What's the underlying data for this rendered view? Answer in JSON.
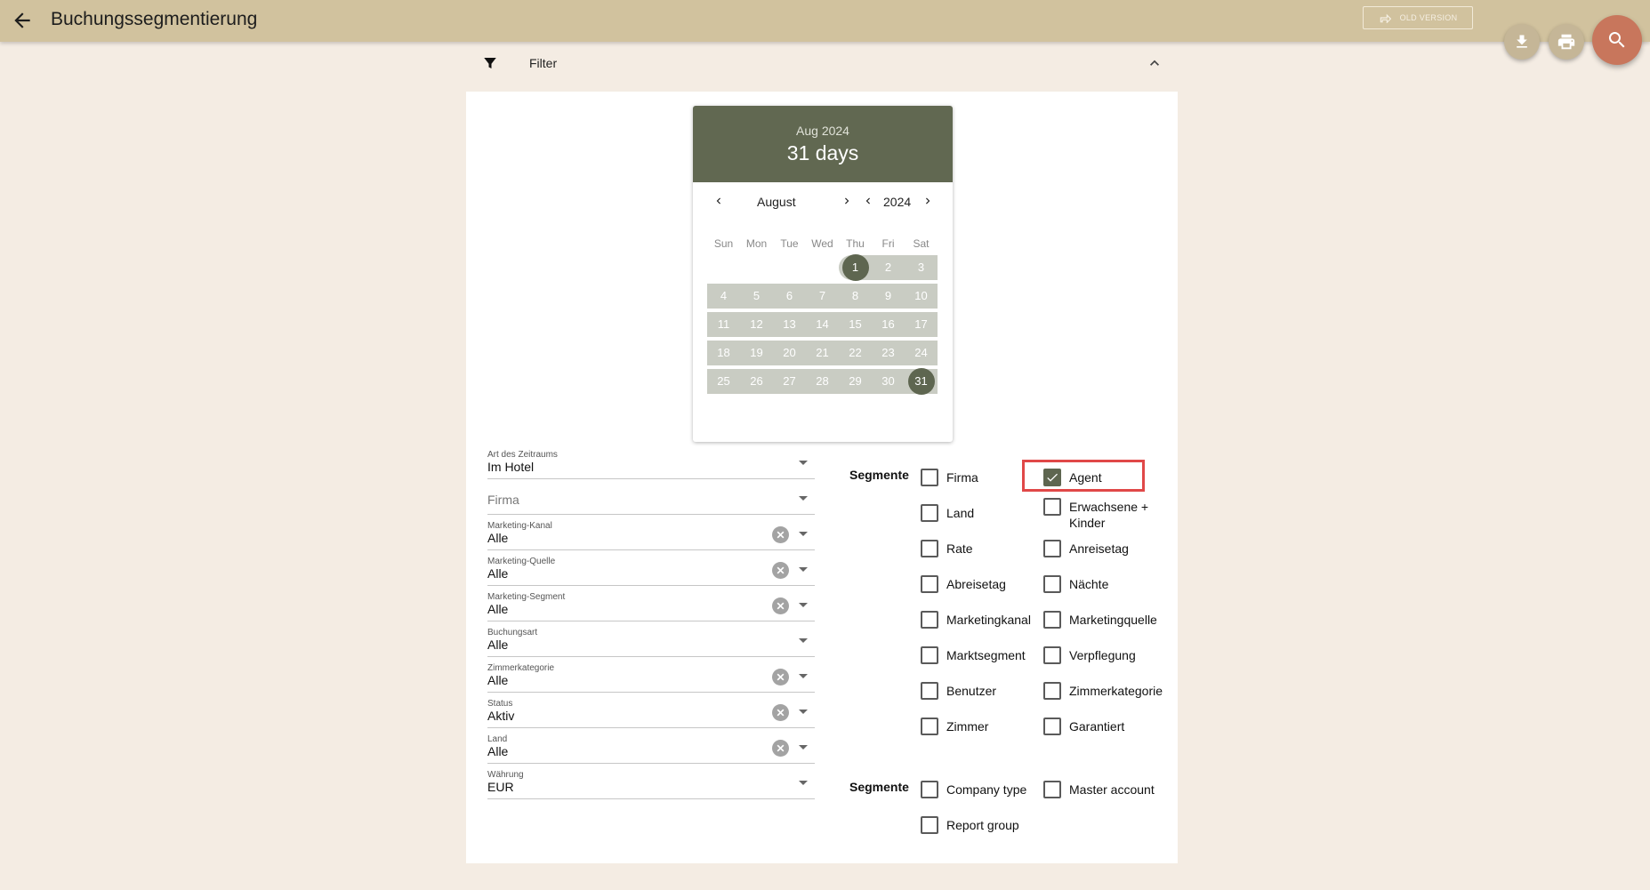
{
  "header": {
    "title": "Buchungssegmentierung",
    "old_version": "OLD VERSION"
  },
  "filter": {
    "label": "Filter"
  },
  "datepicker": {
    "header_month": "Aug 2024",
    "header_days": "31 days",
    "month": "August",
    "year": "2024",
    "weekdays": [
      "Sun",
      "Mon",
      "Tue",
      "Wed",
      "Thu",
      "Fri",
      "Sat"
    ],
    "weeks": [
      [
        "",
        "",
        "",
        "",
        "1",
        "2",
        "3"
      ],
      [
        "4",
        "5",
        "6",
        "7",
        "8",
        "9",
        "10"
      ],
      [
        "11",
        "12",
        "13",
        "14",
        "15",
        "16",
        "17"
      ],
      [
        "18",
        "19",
        "20",
        "21",
        "22",
        "23",
        "24"
      ],
      [
        "25",
        "26",
        "27",
        "28",
        "29",
        "30",
        "31"
      ]
    ],
    "range_start": "1",
    "range_end": "31"
  },
  "fields": [
    {
      "label": "Art des Zeitraums",
      "value": "Im Hotel",
      "clearable": false
    },
    {
      "label": "",
      "placeholder": "Firma",
      "value": "",
      "clearable": false
    },
    {
      "label": "Marketing-Kanal",
      "value": "Alle",
      "clearable": true
    },
    {
      "label": "Marketing-Quelle",
      "value": "Alle",
      "clearable": true
    },
    {
      "label": "Marketing-Segment",
      "value": "Alle",
      "clearable": true
    },
    {
      "label": "Buchungsart",
      "value": "Alle",
      "clearable": false
    },
    {
      "label": "Zimmerkategorie",
      "value": "Alle",
      "clearable": true
    },
    {
      "label": "Status",
      "value": "Aktiv",
      "clearable": true
    },
    {
      "label": "Land",
      "value": "Alle",
      "clearable": true
    },
    {
      "label": "Währung",
      "value": "EUR",
      "clearable": false
    }
  ],
  "segments": {
    "label": "Segmente",
    "items": [
      {
        "label": "Firma",
        "checked": false
      },
      {
        "label": "Agent",
        "checked": true
      },
      {
        "label": "Land",
        "checked": false
      },
      {
        "label": "Erwachsene + Kinder",
        "checked": false
      },
      {
        "label": "Rate",
        "checked": false
      },
      {
        "label": "Anreisetag",
        "checked": false
      },
      {
        "label": "Abreisetag",
        "checked": false
      },
      {
        "label": "Nächte",
        "checked": false
      },
      {
        "label": "Marketingkanal",
        "checked": false
      },
      {
        "label": "Marketingquelle",
        "checked": false
      },
      {
        "label": "Marktsegment",
        "checked": false
      },
      {
        "label": "Verpflegung",
        "checked": false
      },
      {
        "label": "Benutzer",
        "checked": false
      },
      {
        "label": "Zimmerkategorie",
        "checked": false
      },
      {
        "label": "Zimmer",
        "checked": false
      },
      {
        "label": "Garantiert",
        "checked": false
      }
    ]
  },
  "segments2": {
    "label": "Segmente",
    "items": [
      {
        "label": "Company type",
        "checked": false
      },
      {
        "label": "Master account",
        "checked": false
      },
      {
        "label": "Report group",
        "checked": false
      }
    ]
  },
  "colors": {
    "topbar": "#d1c29e",
    "background": "#f4ece3",
    "accent": "#5e6650",
    "search_fab": "#c8765c",
    "highlight": "#e04848"
  }
}
